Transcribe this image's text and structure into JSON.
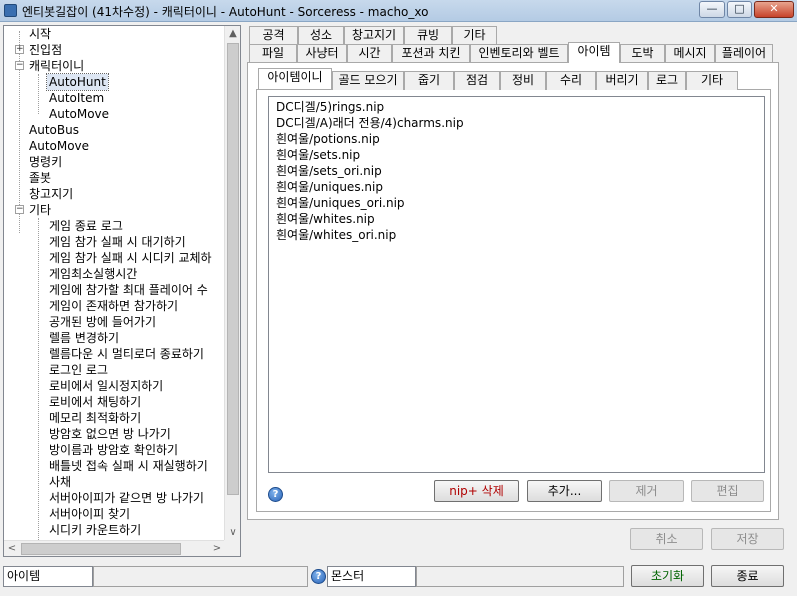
{
  "window": {
    "title": "엔티봇길잡이 (41차수정) - 캐릭터이니 - AutoHunt - Sorceress - macho_xo",
    "minimize": "—",
    "maximize": "□",
    "close": "✕"
  },
  "tree": {
    "items": [
      {
        "label": "시작"
      },
      {
        "label": "진입점"
      },
      {
        "label": "캐릭터이니"
      },
      {
        "label": "AutoHunt"
      },
      {
        "label": "AutoItem"
      },
      {
        "label": "AutoMove"
      },
      {
        "label": "AutoBus"
      },
      {
        "label": "AutoMove"
      },
      {
        "label": "명령키"
      },
      {
        "label": "졸봇"
      },
      {
        "label": "창고지기"
      },
      {
        "label": "기타"
      },
      {
        "label": "게임 종료 로그"
      },
      {
        "label": "게임 참가 실패 시 대기하기"
      },
      {
        "label": "게임 참가 실패 시 시디키 교체하"
      },
      {
        "label": "게임최소실행시간"
      },
      {
        "label": "게임에 참가할 최대 플레이어 수"
      },
      {
        "label": "게임이 존재하면 참가하기"
      },
      {
        "label": "공개된 방에 들어가기"
      },
      {
        "label": "렐름 변경하기"
      },
      {
        "label": "렐름다운 시 멀티로더 종료하기"
      },
      {
        "label": "로그인 로그"
      },
      {
        "label": "로비에서 일시정지하기"
      },
      {
        "label": "로비에서 채팅하기"
      },
      {
        "label": "메모리 최적화하기"
      },
      {
        "label": "방암호 없으면 방 나가기"
      },
      {
        "label": "방이름과 방암호 확인하기"
      },
      {
        "label": "배틀넷 접속 실패 시 재실행하기"
      },
      {
        "label": "사채"
      },
      {
        "label": "서버아이피가 같으면 방 나가기"
      },
      {
        "label": "서버아이피 찾기"
      },
      {
        "label": "시디키 카운트하기"
      }
    ],
    "expander_plus": "+",
    "expander_minus": "−",
    "arrow_up": "▲",
    "arrow_down": "∨",
    "arrow_left": "<",
    "arrow_right": ">"
  },
  "outer_tabs_row1": [
    "공격",
    "성소",
    "창고지기",
    "큐빙",
    "기타"
  ],
  "outer_tabs_row2": [
    "파일",
    "사냥터",
    "시간",
    "포션과 치킨",
    "인벤토리와 벨트",
    "아이템",
    "도박",
    "메시지",
    "플레이어"
  ],
  "inner_tabs": [
    "아이템이니",
    "골드 모으기",
    "줍기",
    "점검",
    "정비",
    "수리",
    "버리기",
    "로그",
    "기타"
  ],
  "file_list": [
    "DC디겔/5)rings.nip",
    "DC디겔/A)래더 전용/4)charms.nip",
    "흰여울/potions.nip",
    "흰여울/sets.nip",
    "흰여울/sets_ori.nip",
    "흰여울/uniques.nip",
    "흰여울/uniques_ori.nip",
    "흰여울/whites.nip",
    "흰여울/whites_ori.nip"
  ],
  "buttons": {
    "nip_delete": "nip+ 삭제",
    "add": "추가...",
    "remove": "제거",
    "edit": "편집",
    "cancel": "취소",
    "save": "저장",
    "reset": "초기화",
    "exit": "종료"
  },
  "help": "?",
  "status": {
    "section": "아이템",
    "field2": "",
    "help": "?",
    "monster_label": "몬스터",
    "monster_value": ""
  },
  "colors": {
    "title_bar": "#b4cbe4",
    "close_button": "#c7432b",
    "delete_text": "#b00000",
    "selection": "#dde6f3"
  }
}
